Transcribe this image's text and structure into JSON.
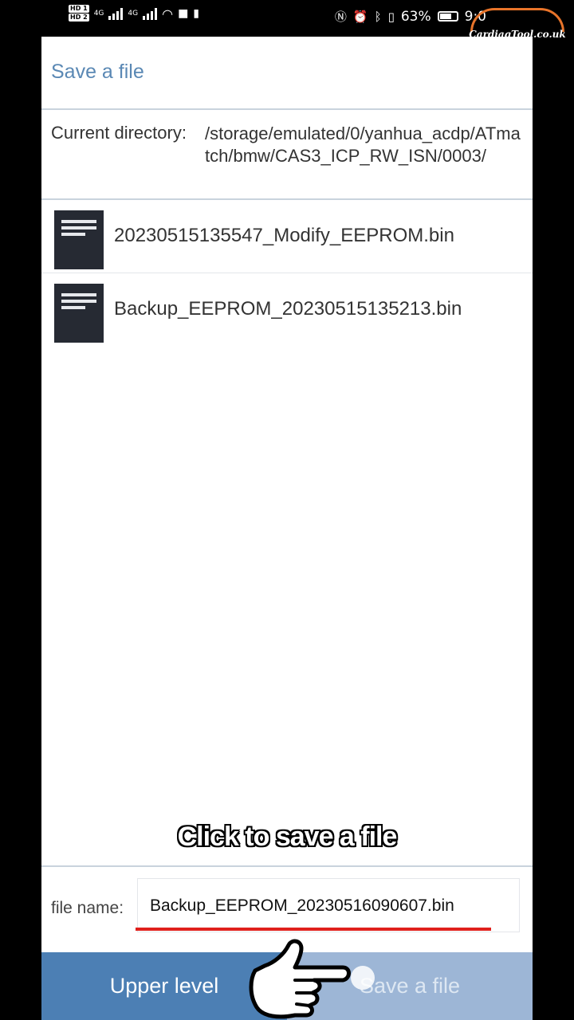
{
  "status_bar": {
    "sim1": "HD 1",
    "sim2": "HD 2",
    "network1": "4G",
    "network2": "4G",
    "battery_percent": "63%",
    "time": "9:0"
  },
  "watermark": {
    "text": "CardiagTool.co.uk"
  },
  "dialog": {
    "title": "Save a file",
    "current_directory_label": "Current directory:",
    "current_directory_path": "/storage/emulated/0/yanhua_acdp/ATmatch/bmw/CAS3_ICP_RW_ISN/0003/",
    "files": [
      {
        "name": "20230515135547_Modify_EEPROM.bin",
        "icon": "document-icon"
      },
      {
        "name": "Backup_EEPROM_20230515135213.bin",
        "icon": "document-icon"
      }
    ],
    "file_name_label": "file name:",
    "file_name_value": "Backup_EEPROM_20230516090607.bin",
    "buttons": {
      "upper_level": "Upper level",
      "save_file": "Save a file"
    }
  },
  "overlay": {
    "caption": "Click to save a file",
    "pointer_icon": "pointing-hand-icon"
  },
  "colors": {
    "title": "#5a88b4",
    "upper_level_button": "#4c7fb4",
    "save_file_button": "#9db6d6",
    "highlight_underline": "#e0201c",
    "file_icon": "#262a33"
  }
}
